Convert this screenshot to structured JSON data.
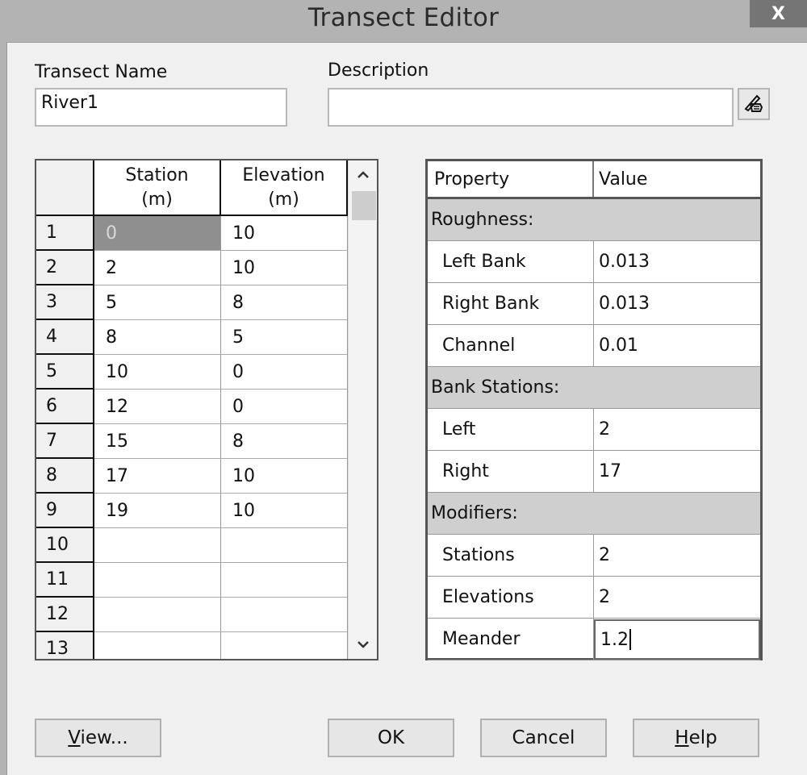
{
  "window": {
    "title": "Transect Editor",
    "close_label": "X"
  },
  "fields": {
    "transect_name_label": "Transect Name",
    "transect_name_value": "River1",
    "description_label": "Description",
    "description_value": "",
    "edit_description_icon": "hand-pencil-icon"
  },
  "station_grid": {
    "columns": [
      {
        "line1": "Station",
        "line2": "(m)"
      },
      {
        "line1": "Elevation",
        "line2": "(m)"
      }
    ],
    "rows": [
      {
        "num": "1",
        "station": "0",
        "elevation": "10",
        "selected": true
      },
      {
        "num": "2",
        "station": "2",
        "elevation": "10"
      },
      {
        "num": "3",
        "station": "5",
        "elevation": "8"
      },
      {
        "num": "4",
        "station": "8",
        "elevation": "5"
      },
      {
        "num": "5",
        "station": "10",
        "elevation": "0"
      },
      {
        "num": "6",
        "station": "12",
        "elevation": "0"
      },
      {
        "num": "7",
        "station": "15",
        "elevation": "8"
      },
      {
        "num": "8",
        "station": "17",
        "elevation": "10"
      },
      {
        "num": "9",
        "station": "19",
        "elevation": "10"
      },
      {
        "num": "10",
        "station": "",
        "elevation": ""
      },
      {
        "num": "11",
        "station": "",
        "elevation": ""
      },
      {
        "num": "12",
        "station": "",
        "elevation": ""
      },
      {
        "num": "13",
        "station": "",
        "elevation": ""
      }
    ],
    "scroll_up_icon": "chevron-up-icon",
    "scroll_down_icon": "chevron-down-icon"
  },
  "property_grid": {
    "headers": {
      "property": "Property",
      "value": "Value"
    },
    "rows": [
      {
        "type": "section",
        "property": "Roughness:",
        "value": ""
      },
      {
        "type": "item",
        "property": "Left Bank",
        "value": "0.013"
      },
      {
        "type": "item",
        "property": "Right Bank",
        "value": "0.013"
      },
      {
        "type": "item",
        "property": "Channel",
        "value": "0.01"
      },
      {
        "type": "section",
        "property": "Bank Stations:",
        "value": ""
      },
      {
        "type": "item",
        "property": "Left",
        "value": "2"
      },
      {
        "type": "item",
        "property": "Right",
        "value": "17"
      },
      {
        "type": "section",
        "property": "Modifiers:",
        "value": ""
      },
      {
        "type": "item",
        "property": "Stations",
        "value": "2"
      },
      {
        "type": "item",
        "property": "Elevations",
        "value": "2"
      },
      {
        "type": "item",
        "property": "Meander",
        "value": "1.2",
        "editing": true
      }
    ]
  },
  "buttons": {
    "view": {
      "accel": "V",
      "rest": "iew..."
    },
    "ok": "OK",
    "cancel": "Cancel",
    "help": {
      "accel": "H",
      "rest": "elp"
    }
  }
}
